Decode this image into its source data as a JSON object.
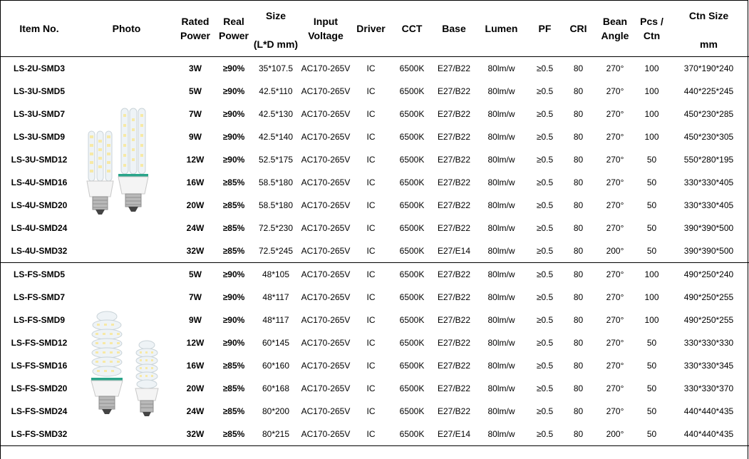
{
  "headers": {
    "item_no": "Item No.",
    "photo": "Photo",
    "rated_power": [
      "Rated",
      "Power"
    ],
    "real_power": [
      "Real",
      "Power"
    ],
    "size": [
      "Size",
      "(L*D mm)"
    ],
    "input_voltage": [
      "Input",
      "Voltage"
    ],
    "driver": "Driver",
    "cct": "CCT",
    "base": "Base",
    "lumen": "Lumen",
    "pf": "PF",
    "cri": "CRI",
    "beam_angle": [
      "Bean",
      "Angle"
    ],
    "pcs_ctn": [
      "Pcs /",
      "Ctn"
    ],
    "ctn_size": [
      "Ctn Size",
      "mm"
    ]
  },
  "photos": {
    "group1": "u-shape-led-corn-bulbs",
    "group2": "spiral-led-corn-bulbs"
  },
  "rows": [
    {
      "item": "LS-2U-SMD3",
      "rated": "3W",
      "real": "≥90%",
      "size": "35*107.5",
      "voltage": "AC170-265V",
      "driver": "IC",
      "cct": "6500K",
      "base": "E27/B22",
      "lumen": "80lm/w",
      "pf": "≥0.5",
      "cri": "80",
      "angle": "270°",
      "pcs": "100",
      "ctn": "370*190*240"
    },
    {
      "item": "LS-3U-SMD5",
      "rated": "5W",
      "real": "≥90%",
      "size": "42.5*110",
      "voltage": "AC170-265V",
      "driver": "IC",
      "cct": "6500K",
      "base": "E27/B22",
      "lumen": "80lm/w",
      "pf": "≥0.5",
      "cri": "80",
      "angle": "270°",
      "pcs": "100",
      "ctn": "440*225*245"
    },
    {
      "item": "LS-3U-SMD7",
      "rated": "7W",
      "real": "≥90%",
      "size": "42.5*130",
      "voltage": "AC170-265V",
      "driver": "IC",
      "cct": "6500K",
      "base": "E27/B22",
      "lumen": "80lm/w",
      "pf": "≥0.5",
      "cri": "80",
      "angle": "270°",
      "pcs": "100",
      "ctn": "450*230*285"
    },
    {
      "item": "LS-3U-SMD9",
      "rated": "9W",
      "real": "≥90%",
      "size": "42.5*140",
      "voltage": "AC170-265V",
      "driver": "IC",
      "cct": "6500K",
      "base": "E27/B22",
      "lumen": "80lm/w",
      "pf": "≥0.5",
      "cri": "80",
      "angle": "270°",
      "pcs": "100",
      "ctn": "450*230*305"
    },
    {
      "item": "LS-3U-SMD12",
      "rated": "12W",
      "real": "≥90%",
      "size": "52.5*175",
      "voltage": "AC170-265V",
      "driver": "IC",
      "cct": "6500K",
      "base": "E27/B22",
      "lumen": "80lm/w",
      "pf": "≥0.5",
      "cri": "80",
      "angle": "270°",
      "pcs": "50",
      "ctn": "550*280*195"
    },
    {
      "item": "LS-4U-SMD16",
      "rated": "16W",
      "real": "≥85%",
      "size": "58.5*180",
      "voltage": "AC170-265V",
      "driver": "IC",
      "cct": "6500K",
      "base": "E27/B22",
      "lumen": "80lm/w",
      "pf": "≥0.5",
      "cri": "80",
      "angle": "270°",
      "pcs": "50",
      "ctn": "330*330*405"
    },
    {
      "item": "LS-4U-SMD20",
      "rated": "20W",
      "real": "≥85%",
      "size": "58.5*180",
      "voltage": "AC170-265V",
      "driver": "IC",
      "cct": "6500K",
      "base": "E27/B22",
      "lumen": "80lm/w",
      "pf": "≥0.5",
      "cri": "80",
      "angle": "270°",
      "pcs": "50",
      "ctn": "330*330*405"
    },
    {
      "item": "LS-4U-SMD24",
      "rated": "24W",
      "real": "≥85%",
      "size": "72.5*230",
      "voltage": "AC170-265V",
      "driver": "IC",
      "cct": "6500K",
      "base": "E27/B22",
      "lumen": "80lm/w",
      "pf": "≥0.5",
      "cri": "80",
      "angle": "270°",
      "pcs": "50",
      "ctn": "390*390*500"
    },
    {
      "item": "LS-4U-SMD32",
      "rated": "32W",
      "real": "≥85%",
      "size": "72.5*245",
      "voltage": "AC170-265V",
      "driver": "IC",
      "cct": "6500K",
      "base": "E27/E14",
      "lumen": "80lm/w",
      "pf": "≥0.5",
      "cri": "80",
      "angle": "200°",
      "pcs": "50",
      "ctn": "390*390*500"
    },
    {
      "item": "LS-FS-SMD5",
      "rated": "5W",
      "real": "≥90%",
      "size": "48*105",
      "voltage": "AC170-265V",
      "driver": "IC",
      "cct": "6500K",
      "base": "E27/B22",
      "lumen": "80lm/w",
      "pf": "≥0.5",
      "cri": "80",
      "angle": "270°",
      "pcs": "100",
      "ctn": "490*250*240"
    },
    {
      "item": "LS-FS-SMD7",
      "rated": "7W",
      "real": "≥90%",
      "size": "48*117",
      "voltage": "AC170-265V",
      "driver": "IC",
      "cct": "6500K",
      "base": "E27/B22",
      "lumen": "80lm/w",
      "pf": "≥0.5",
      "cri": "80",
      "angle": "270°",
      "pcs": "100",
      "ctn": "490*250*255"
    },
    {
      "item": "LS-FS-SMD9",
      "rated": "9W",
      "real": "≥90%",
      "size": "48*117",
      "voltage": "AC170-265V",
      "driver": "IC",
      "cct": "6500K",
      "base": "E27/B22",
      "lumen": "80lm/w",
      "pf": "≥0.5",
      "cri": "80",
      "angle": "270°",
      "pcs": "100",
      "ctn": "490*250*255"
    },
    {
      "item": "LS-FS-SMD12",
      "rated": "12W",
      "real": "≥90%",
      "size": "60*145",
      "voltage": "AC170-265V",
      "driver": "IC",
      "cct": "6500K",
      "base": "E27/B22",
      "lumen": "80lm/w",
      "pf": "≥0.5",
      "cri": "80",
      "angle": "270°",
      "pcs": "50",
      "ctn": "330*330*330"
    },
    {
      "item": "LS-FS-SMD16",
      "rated": "16W",
      "real": "≥85%",
      "size": "60*160",
      "voltage": "AC170-265V",
      "driver": "IC",
      "cct": "6500K",
      "base": "E27/B22",
      "lumen": "80lm/w",
      "pf": "≥0.5",
      "cri": "80",
      "angle": "270°",
      "pcs": "50",
      "ctn": "330*330*345"
    },
    {
      "item": "LS-FS-SMD20",
      "rated": "20W",
      "real": "≥85%",
      "size": "60*168",
      "voltage": "AC170-265V",
      "driver": "IC",
      "cct": "6500K",
      "base": "E27/B22",
      "lumen": "80lm/w",
      "pf": "≥0.5",
      "cri": "80",
      "angle": "270°",
      "pcs": "50",
      "ctn": "330*330*370"
    },
    {
      "item": "LS-FS-SMD24",
      "rated": "24W",
      "real": "≥85%",
      "size": "80*200",
      "voltage": "AC170-265V",
      "driver": "IC",
      "cct": "6500K",
      "base": "E27/B22",
      "lumen": "80lm/w",
      "pf": "≥0.5",
      "cri": "80",
      "angle": "270°",
      "pcs": "50",
      "ctn": "440*440*435"
    },
    {
      "item": "LS-FS-SMD32",
      "rated": "32W",
      "real": "≥85%",
      "size": "80*215",
      "voltage": "AC170-265V",
      "driver": "IC",
      "cct": "6500K",
      "base": "E27/E14",
      "lumen": "80lm/w",
      "pf": "≥0.5",
      "cri": "80",
      "angle": "200°",
      "pcs": "50",
      "ctn": "440*440*435"
    }
  ]
}
